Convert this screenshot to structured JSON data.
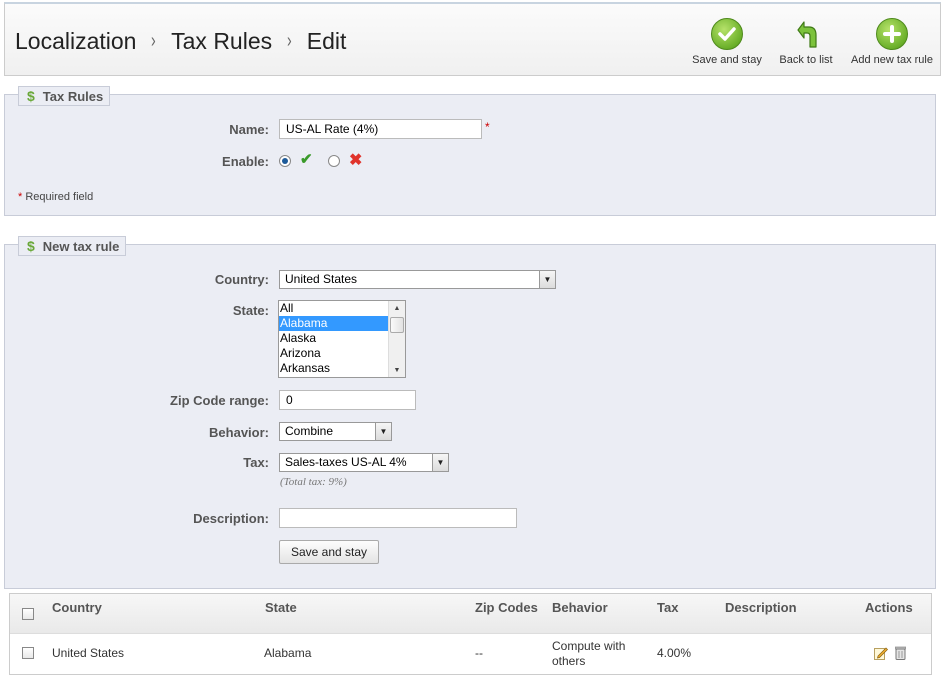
{
  "breadcrumb": {
    "items": [
      "Localization",
      "Tax Rules",
      "Edit"
    ],
    "separator": "›"
  },
  "toolbar": {
    "save_and_stay": "Save and stay",
    "back_to_list": "Back to list",
    "add_new_tax_rule": "Add new tax rule"
  },
  "tax_rules_section": {
    "legend": "Tax Rules",
    "name_label": "Name:",
    "name_value": "US-AL Rate (4%)",
    "enable_label": "Enable:",
    "enabled": true,
    "required_note": "Required field",
    "required_mark": "*"
  },
  "new_rule_section": {
    "legend": "New tax rule",
    "country_label": "Country:",
    "country_value": "United States",
    "state_label": "State:",
    "states": [
      "All",
      "Alabama",
      "Alaska",
      "Arizona",
      "Arkansas"
    ],
    "selected_state": "Alabama",
    "zip_label": "Zip Code range:",
    "zip_value": "0",
    "behavior_label": "Behavior:",
    "behavior_value": "Combine",
    "tax_label": "Tax:",
    "tax_value": "Sales-taxes US-AL 4%",
    "total_tax_hint": "(Total tax: 9%)",
    "description_label": "Description:",
    "description_value": "",
    "save_button": "Save and stay"
  },
  "rules_table": {
    "headers": [
      "Country",
      "State",
      "Zip Codes",
      "Behavior",
      "Tax",
      "Description",
      "Actions"
    ],
    "rows": [
      {
        "country": "United States",
        "state": "Alabama",
        "zip": "--",
        "behavior_line1": "Compute with",
        "behavior_line2": "others",
        "tax": "4.00%",
        "description": ""
      }
    ]
  },
  "colors": {
    "accent_green": "#6bb02a",
    "panel_bg": "#ebedf4",
    "selection_blue": "#3399ff",
    "required_red": "#cc0000"
  }
}
